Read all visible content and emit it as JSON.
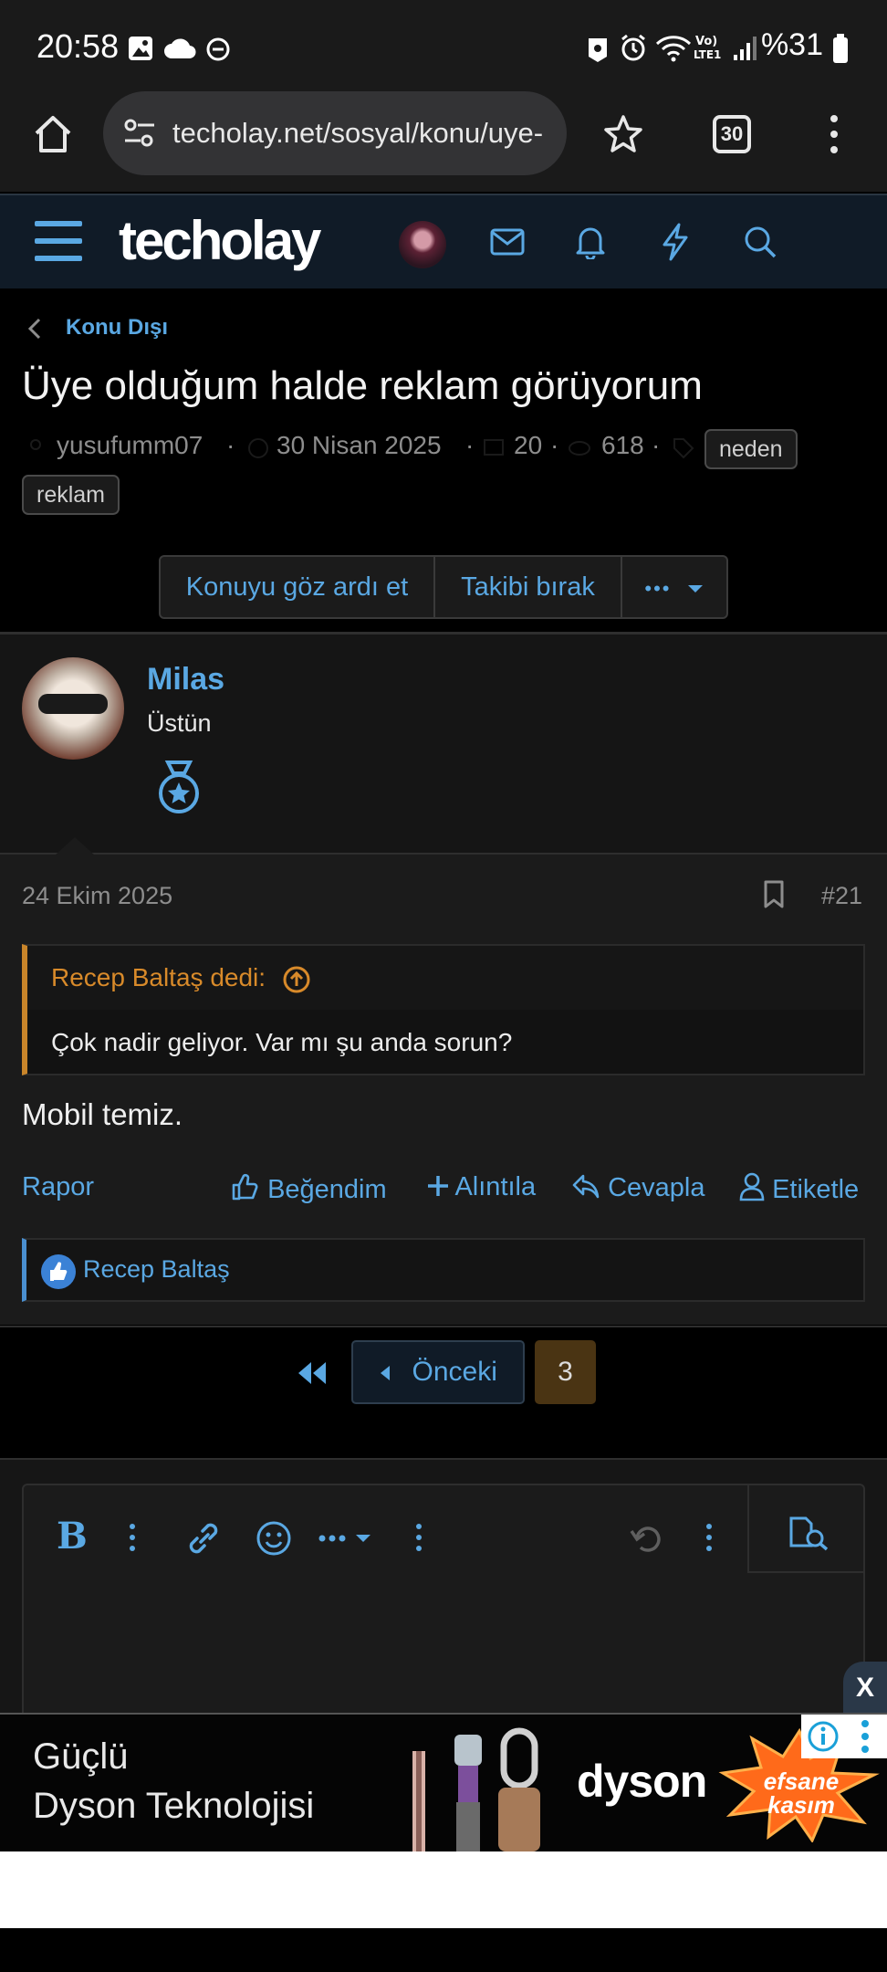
{
  "status_bar": {
    "time": "20:58",
    "battery": "%31",
    "icons": [
      "gallery-icon",
      "cloud-icon",
      "dnd-icon",
      "vpn-icon",
      "alarm-icon",
      "wifi-icon",
      "volte-icon",
      "signal-icon",
      "battery-icon"
    ]
  },
  "browser": {
    "url": "techolay.net/sosyal/konu/uye-",
    "tab_count": "30"
  },
  "site": {
    "logo": "techolay"
  },
  "thread": {
    "breadcrumb": "Konu Dışı",
    "title": "Üye olduğum halde reklam görüyorum",
    "author": "yusufumm07",
    "date": "30 Nisan 2025",
    "replies": "20",
    "views": "618",
    "tags": [
      "neden",
      "reklam"
    ],
    "buttons": {
      "ignore": "Konuyu göz ardı et",
      "unwatch": "Takibi bırak",
      "more": "•••"
    }
  },
  "post": {
    "username": "Milas",
    "user_title": "Üstün",
    "date": "24 Ekim 2025",
    "number": "#21",
    "quote_author": "Recep Baltaş dedi:",
    "quote_text": "Çok nadir geliyor. Var mı şu anda sorun?",
    "text": "Mobil temiz.",
    "actions": {
      "report": "Rapor",
      "like": "Beğendim",
      "quote": "Alıntıla",
      "reply": "Cevapla",
      "tag": "Etiketle"
    },
    "reaction_user": "Recep Baltaş"
  },
  "pagination": {
    "prev": "Önceki",
    "current": "3"
  },
  "ad": {
    "close": "X",
    "line1": "Güçlü",
    "line2": "Dyson Teknolojisi",
    "brand": "dyson",
    "badge_line1": "efsane",
    "badge_line2": "kasım"
  },
  "colors": {
    "accent": "#5aa8e3",
    "quote_border": "#c9852a",
    "header_bg": "#101b27"
  }
}
